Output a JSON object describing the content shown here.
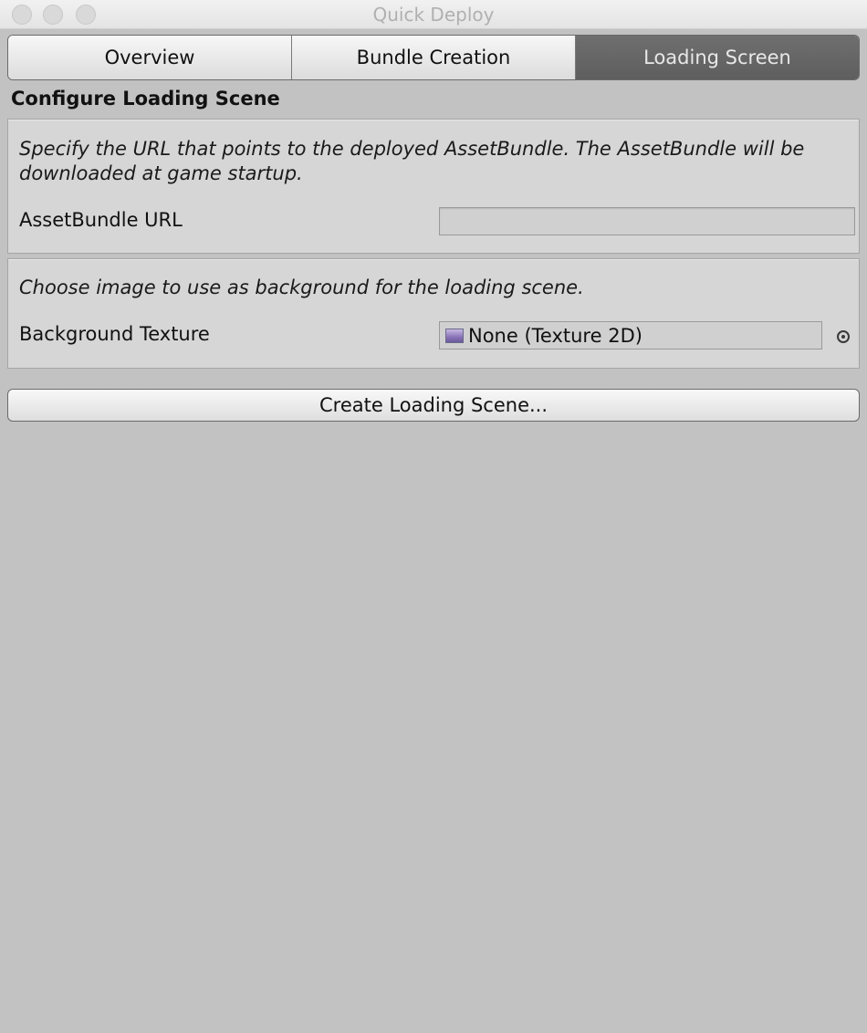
{
  "window": {
    "title": "Quick Deploy"
  },
  "tabs": [
    {
      "label": "Overview",
      "active": false
    },
    {
      "label": "Bundle Creation",
      "active": false
    },
    {
      "label": "Loading Screen",
      "active": true
    }
  ],
  "heading": "Configure Loading Scene",
  "url_section": {
    "description": "Specify the URL that points to the deployed AssetBundle. The AssetBundle will be downloaded at game startup.",
    "field_label": "AssetBundle URL",
    "field_value": ""
  },
  "texture_section": {
    "description": "Choose image to use as background for the loading scene.",
    "field_label": "Background Texture",
    "field_value": "None (Texture 2D)",
    "icon": "texture-icon"
  },
  "create_button": {
    "label": "Create Loading Scene..."
  }
}
